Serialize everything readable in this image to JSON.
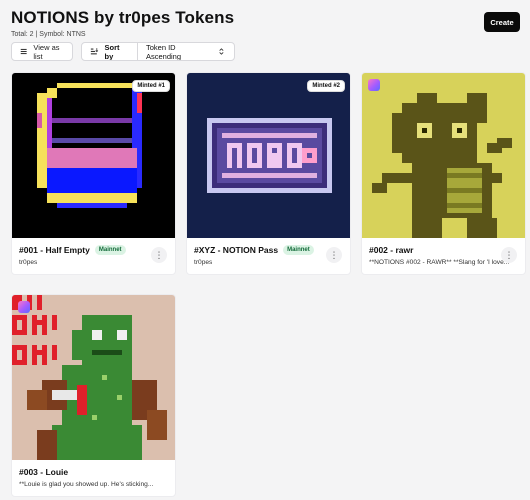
{
  "page": {
    "title": "NOTIONS by tr0pes Tokens",
    "subtitle": "Total: 2 | Symbol: NTNS",
    "create_label": "Create"
  },
  "toolbar": {
    "view_label": "View as list",
    "sort_label": "Sort by",
    "sort_value": "Token ID Ascending"
  },
  "icons": {
    "view": "list-icon",
    "sort": "sort-icon",
    "dropdown": "chevron-updown-icon",
    "more": "more-vertical-icon",
    "chain": "polygon-chain-icon"
  },
  "colors": {
    "badge_bg": "#dbf3e4",
    "badge_text": "#136b3a",
    "create_bg": "#0a0a0a"
  },
  "cards": [
    {
      "name": "#001 - Half Empty",
      "badge": "Mainnet",
      "sub": "tr0pes",
      "minted": "Minted #1"
    },
    {
      "name": "#XYZ - NOTION Pass",
      "badge": "Mainnet",
      "sub": "tr0pes",
      "minted": "Minted #2"
    },
    {
      "name": "#002 - rawr",
      "badge": "",
      "sub": "**NOTIONS #002 - RAWR** **Slang for 'I love...",
      "minted": ""
    },
    {
      "name": "#003 - Louie",
      "badge": "",
      "sub": "**Louie is glad you showed up. He's sticking...",
      "minted": ""
    }
  ]
}
